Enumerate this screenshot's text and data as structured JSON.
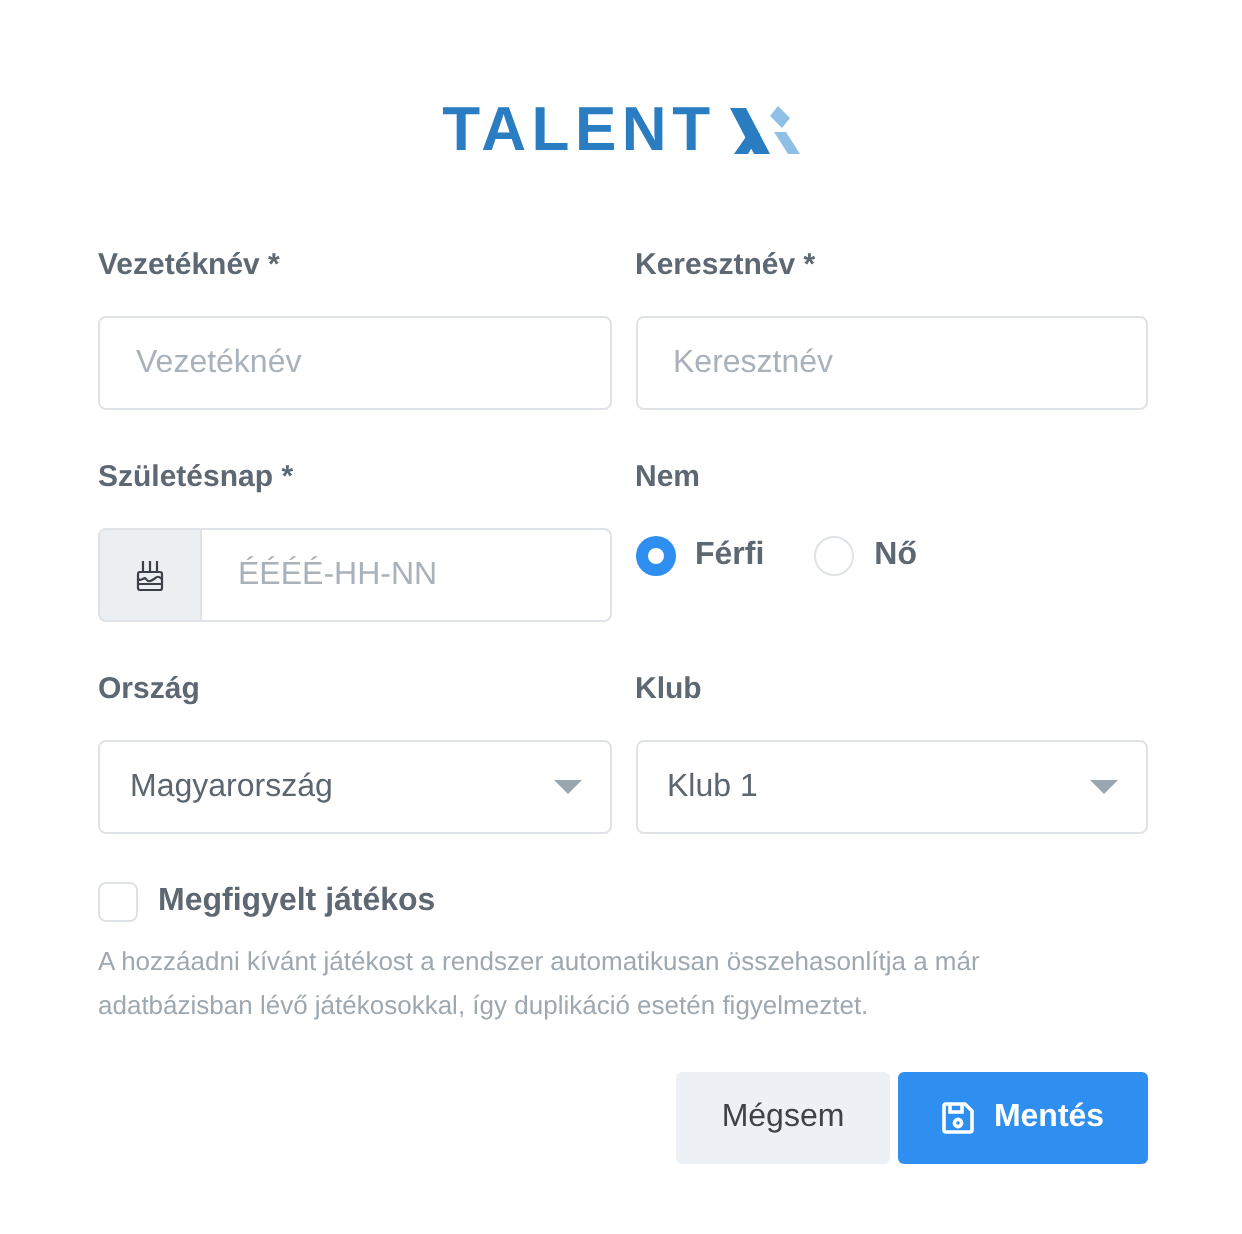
{
  "logo": {
    "text": "TALENT"
  },
  "rows": [
    [
      {
        "kind": "text",
        "label": "Vezetéknév *",
        "placeholder": "Vezetéknév"
      },
      {
        "kind": "text",
        "label": "Keresztnév *",
        "placeholder": "Keresztnév"
      }
    ],
    [
      {
        "kind": "date",
        "label": "Születésnap *",
        "placeholder": "ÉÉÉÉ-HH-NN"
      },
      {
        "kind": "radio",
        "label": "Nem",
        "options": [
          {
            "label": "Férfi",
            "selected": true
          },
          {
            "label": "Nő",
            "selected": false
          }
        ]
      }
    ],
    [
      {
        "kind": "select",
        "label": "Ország",
        "value": "Magyarország"
      },
      {
        "kind": "select",
        "label": "Klub",
        "value": "Klub 1"
      }
    ]
  ],
  "checkbox": {
    "label": "Megfigyelt játékos",
    "checked": false
  },
  "help_text": "A hozzáadni kívánt játékost a rendszer automatikusan összehasonlítja a már adatbázisban lévő játékosokkal, így duplikáció esetén figyelmeztet.",
  "buttons": [
    {
      "kind": "secondary",
      "label": "Mégsem"
    },
    {
      "kind": "primary",
      "label": "Mentés"
    }
  ]
}
